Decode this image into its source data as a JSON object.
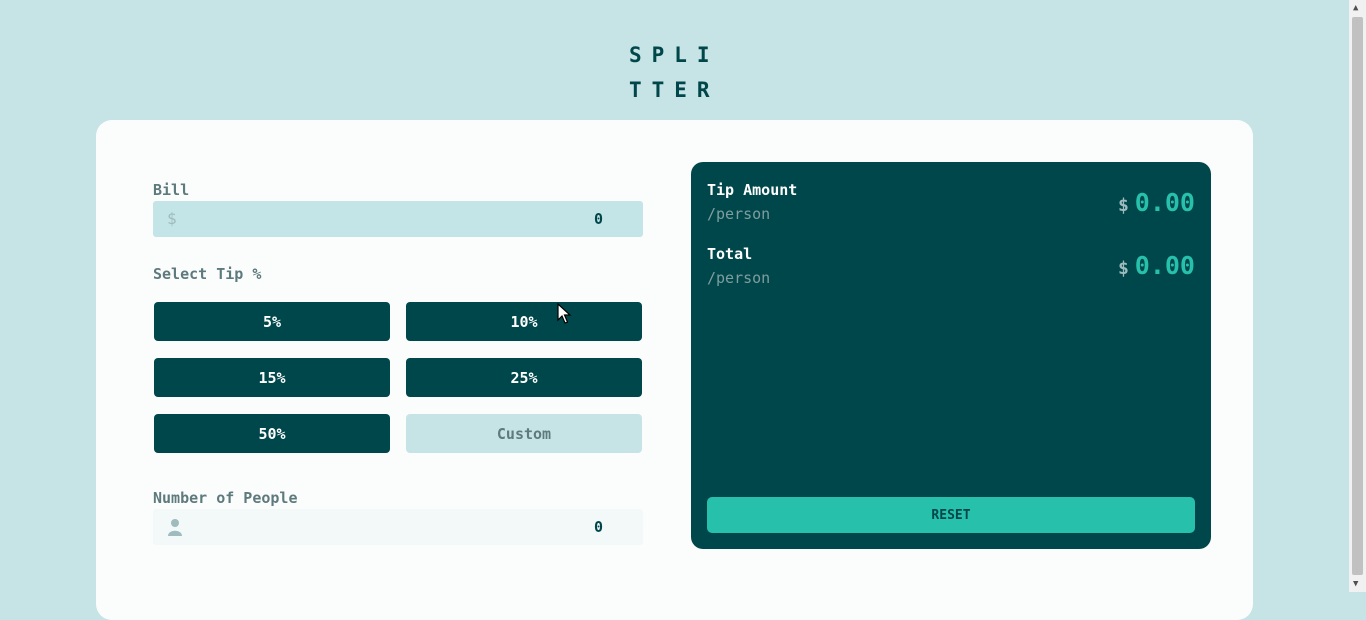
{
  "app": {
    "logo_line1": "SPLI",
    "logo_line2": "TTER"
  },
  "bill": {
    "label": "Bill",
    "currency": "$",
    "value": "0"
  },
  "tip": {
    "label": "Select Tip %",
    "options": [
      "5%",
      "10%",
      "15%",
      "25%",
      "50%"
    ],
    "custom_label": "Custom"
  },
  "people": {
    "label": "Number of People",
    "value": "0"
  },
  "results": {
    "tip_title": "Tip Amount",
    "tip_sub": "/person",
    "tip_currency": "$",
    "tip_value": "0.00",
    "total_title": "Total",
    "total_sub": "/person",
    "total_currency": "$",
    "total_value": "0.00",
    "reset_label": "RESET"
  },
  "colors": {
    "background": "#c6e3e5",
    "dark_teal": "#00474b",
    "accent": "#26c0ab"
  }
}
